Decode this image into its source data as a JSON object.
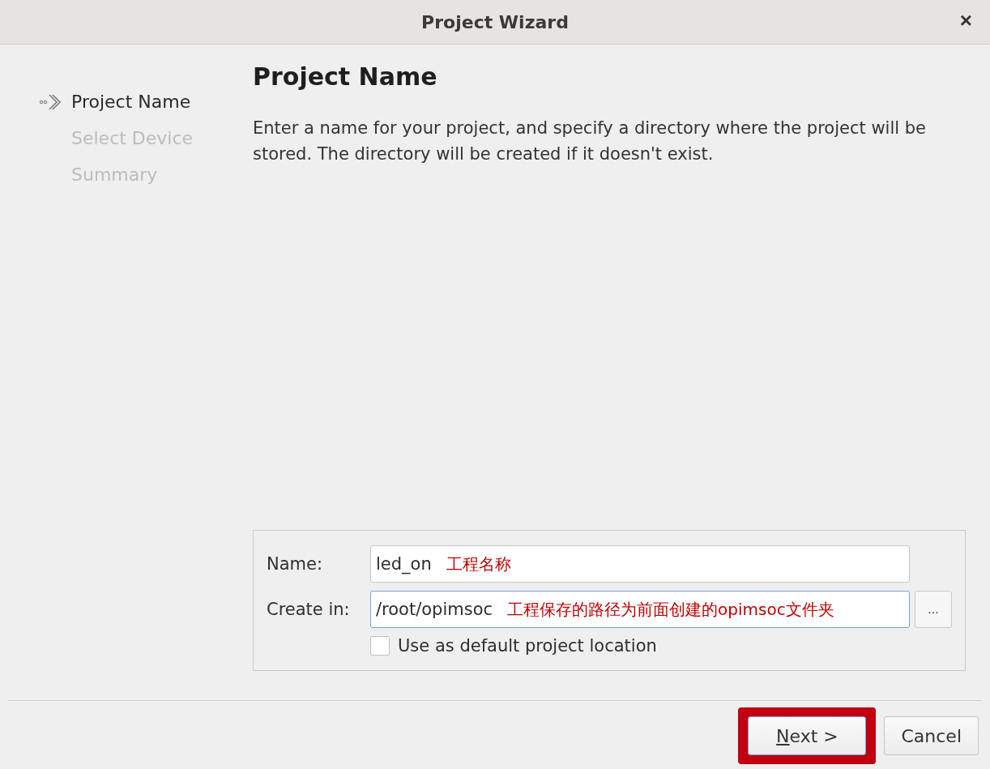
{
  "window": {
    "title": "Project Wizard",
    "close": "×"
  },
  "steps": [
    {
      "label": "Project Name",
      "selected": true
    },
    {
      "label": "Select Device",
      "selected": false
    },
    {
      "label": "Summary",
      "selected": false
    }
  ],
  "page": {
    "heading": "Project Name",
    "description": "Enter a name for your project, and specify a directory where the project will be stored. The directory will be created if it doesn't exist."
  },
  "form": {
    "fields": [
      {
        "label": "Name:",
        "value": "led_on",
        "annotation": "工程名称",
        "focused": false
      },
      {
        "label": "Create in:",
        "value": "/root/opimsoc",
        "annotation": "工程保存的路径为前面创建的opimsoc文件夹",
        "focused": true,
        "browse": "..."
      }
    ],
    "checkbox": {
      "label": "Use as default project location",
      "checked": false
    }
  },
  "buttons": [
    {
      "label": "Next >",
      "highlighted": true,
      "default": true
    },
    {
      "label": "Cancel",
      "highlighted": false,
      "default": false
    }
  ]
}
